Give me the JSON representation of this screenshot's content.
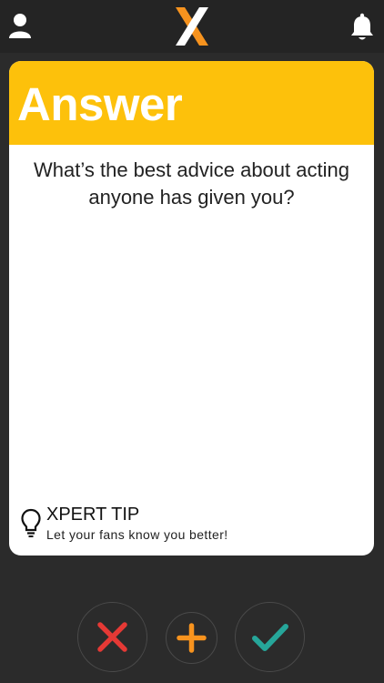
{
  "header": {
    "profile_icon": "person-icon",
    "logo_icon": "x-logo",
    "notification_icon": "bell-icon",
    "accent_color": "#f7931e"
  },
  "card": {
    "title": "Answer",
    "header_color": "#fdc10b",
    "question": "What’s the best advice about acting anyone has given you?",
    "tip": {
      "icon": "lightbulb-icon",
      "title": "XPERT TIP",
      "text": "Let your fans know you better!"
    }
  },
  "actions": {
    "reject_icon": "x-mark-icon",
    "reject_color": "#e53935",
    "add_icon": "plus-icon",
    "add_color": "#f7931e",
    "accept_icon": "checkmark-icon",
    "accept_color": "#26a69a"
  }
}
